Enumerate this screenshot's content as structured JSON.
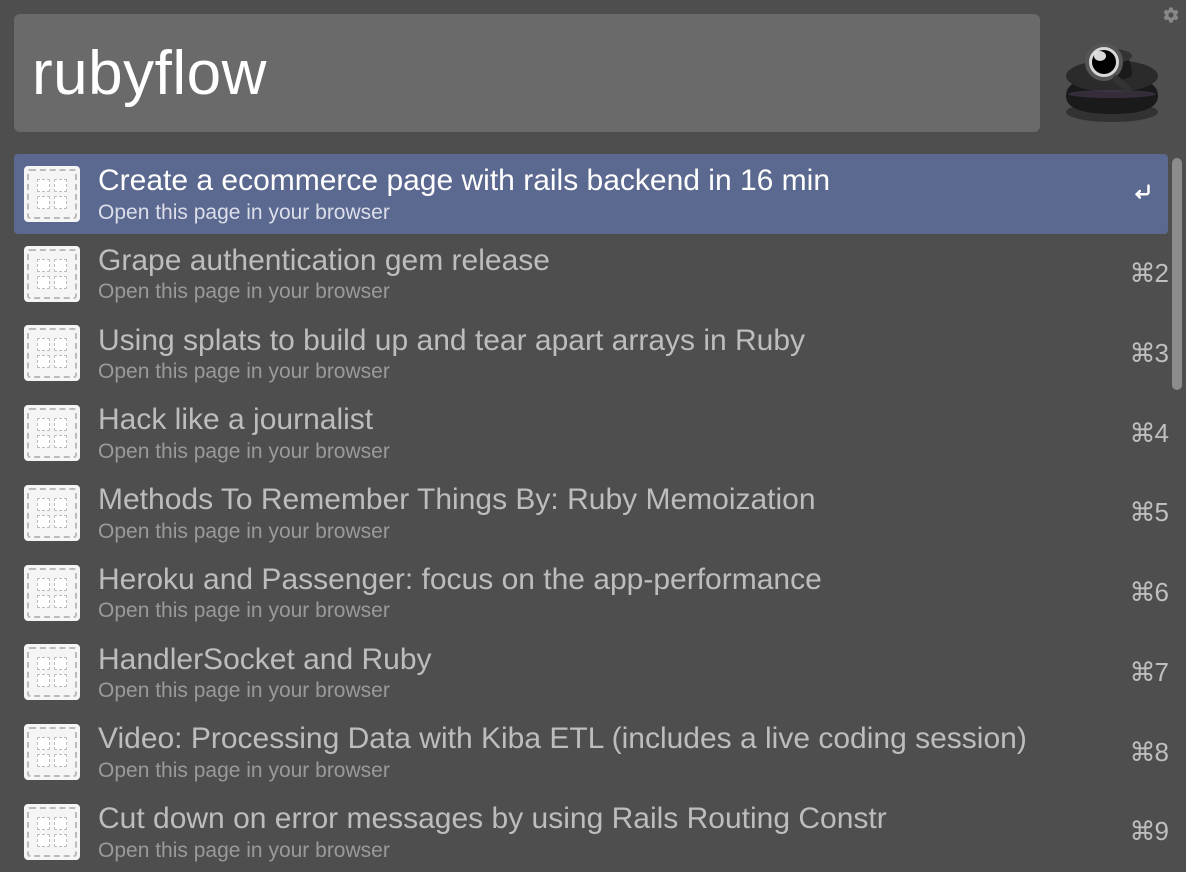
{
  "search": {
    "value": "rubyflow"
  },
  "results": {
    "subtitle_text": "Open this page in your browser",
    "items": [
      {
        "title": "Create a ecommerce page with rails backend in 16 min",
        "shortcut": "↩",
        "selected": true
      },
      {
        "title": "Grape authentication gem release",
        "shortcut": "⌘2",
        "selected": false
      },
      {
        "title": "Using splats to build up and tear apart arrays in Ruby",
        "shortcut": "⌘3",
        "selected": false
      },
      {
        "title": "Hack like a journalist",
        "shortcut": "⌘4",
        "selected": false
      },
      {
        "title": "Methods To Remember Things By: Ruby Memoization",
        "shortcut": "⌘5",
        "selected": false
      },
      {
        "title": "Heroku and Passenger: focus on the app-performance",
        "shortcut": "⌘6",
        "selected": false
      },
      {
        "title": "HandlerSocket and Ruby",
        "shortcut": "⌘7",
        "selected": false
      },
      {
        "title": "Video: Processing Data with Kiba ETL (includes a live coding session)",
        "shortcut": "⌘8",
        "selected": false
      },
      {
        "title": "Cut down on error messages by using Rails Routing Constr",
        "shortcut": "⌘9",
        "selected": false
      }
    ]
  }
}
